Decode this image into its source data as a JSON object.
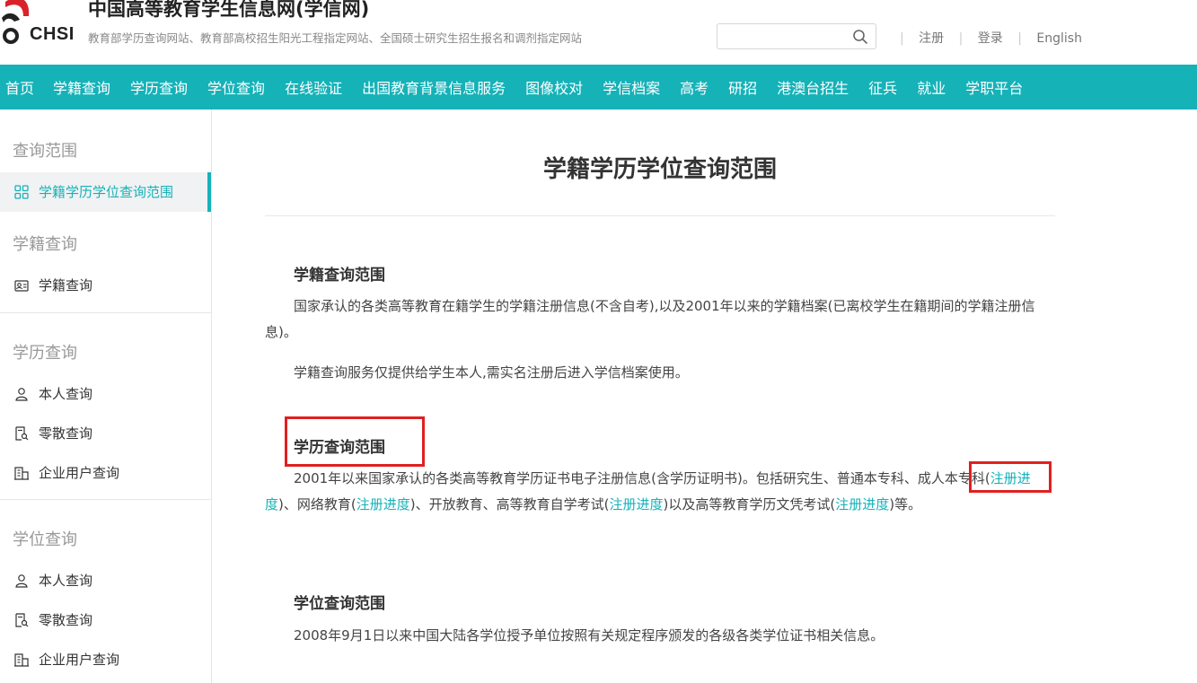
{
  "header": {
    "logo_text": "CHSI",
    "site_title": "中国高等教育学生信息网(学信网)",
    "site_subtitle": "教育部学历查询网站、教育部高校招生阳光工程指定网站、全国硕士研究生招生报名和调剂指定网站",
    "search_placeholder": "",
    "links": {
      "register": "注册",
      "login": "登录",
      "english": "English"
    }
  },
  "nav": [
    "首页",
    "学籍查询",
    "学历查询",
    "学位查询",
    "在线验证",
    "出国教育背景信息服务",
    "图像校对",
    "学信档案",
    "高考",
    "研招",
    "港澳台招生",
    "征兵",
    "就业",
    "学职平台"
  ],
  "sidebar": {
    "groups": [
      {
        "title": "查询范围",
        "items": [
          {
            "label": "学籍学历学位查询范围",
            "icon": "grid-icon"
          }
        ]
      },
      {
        "title": "学籍查询",
        "items": [
          {
            "label": "学籍查询",
            "icon": "id-card-icon"
          }
        ]
      },
      {
        "title": "学历查询",
        "items": [
          {
            "label": "本人查询",
            "icon": "user-icon"
          },
          {
            "label": "零散查询",
            "icon": "document-search-icon"
          },
          {
            "label": "企业用户查询",
            "icon": "building-icon"
          }
        ]
      },
      {
        "title": "学位查询",
        "items": [
          {
            "label": "本人查询",
            "icon": "user-icon"
          },
          {
            "label": "零散查询",
            "icon": "document-search-icon"
          },
          {
            "label": "企业用户查询",
            "icon": "building-icon"
          }
        ]
      }
    ]
  },
  "content": {
    "page_title": "学籍学历学位查询范围",
    "s1_title": "学籍查询范围",
    "s1_p1": "国家承认的各类高等教育在籍学生的学籍注册信息(不含自考),以及2001年以来的学籍档案(已离校学生在籍期间的学籍注册信息)。",
    "s1_p2": "学籍查询服务仅提供给学生本人,需实名注册后进入学信档案使用。",
    "s2_title": "学历查询范围",
    "s2_p_a": "2001年以来国家承认的各类高等教育学历证书电子注册信息(含学历证明书)。包括研究生、普通本专科、",
    "s2_p_hl": "成人本专科",
    "s2_p_b": "(",
    "s2_link1": "注册进度",
    "s2_p_c": ")、网络教育(",
    "s2_link2": "注册进度",
    "s2_p_d": ")、开放教育、高等教育自学考试(",
    "s2_link3": "注册进度",
    "s2_p_e": ")以及高等教育学历文凭考试(",
    "s2_link4": "注册进度",
    "s2_p_f": ")等。",
    "s3_title": "学位查询范围",
    "s3_p1": "2008年9月1日以来中国大陆各学位授予单位按照有关规定程序颁发的各级各类学位证书相关信息。"
  },
  "colors": {
    "accent": "#15b2b8",
    "highlight": "#e02020",
    "logo_red": "#d8232a"
  }
}
